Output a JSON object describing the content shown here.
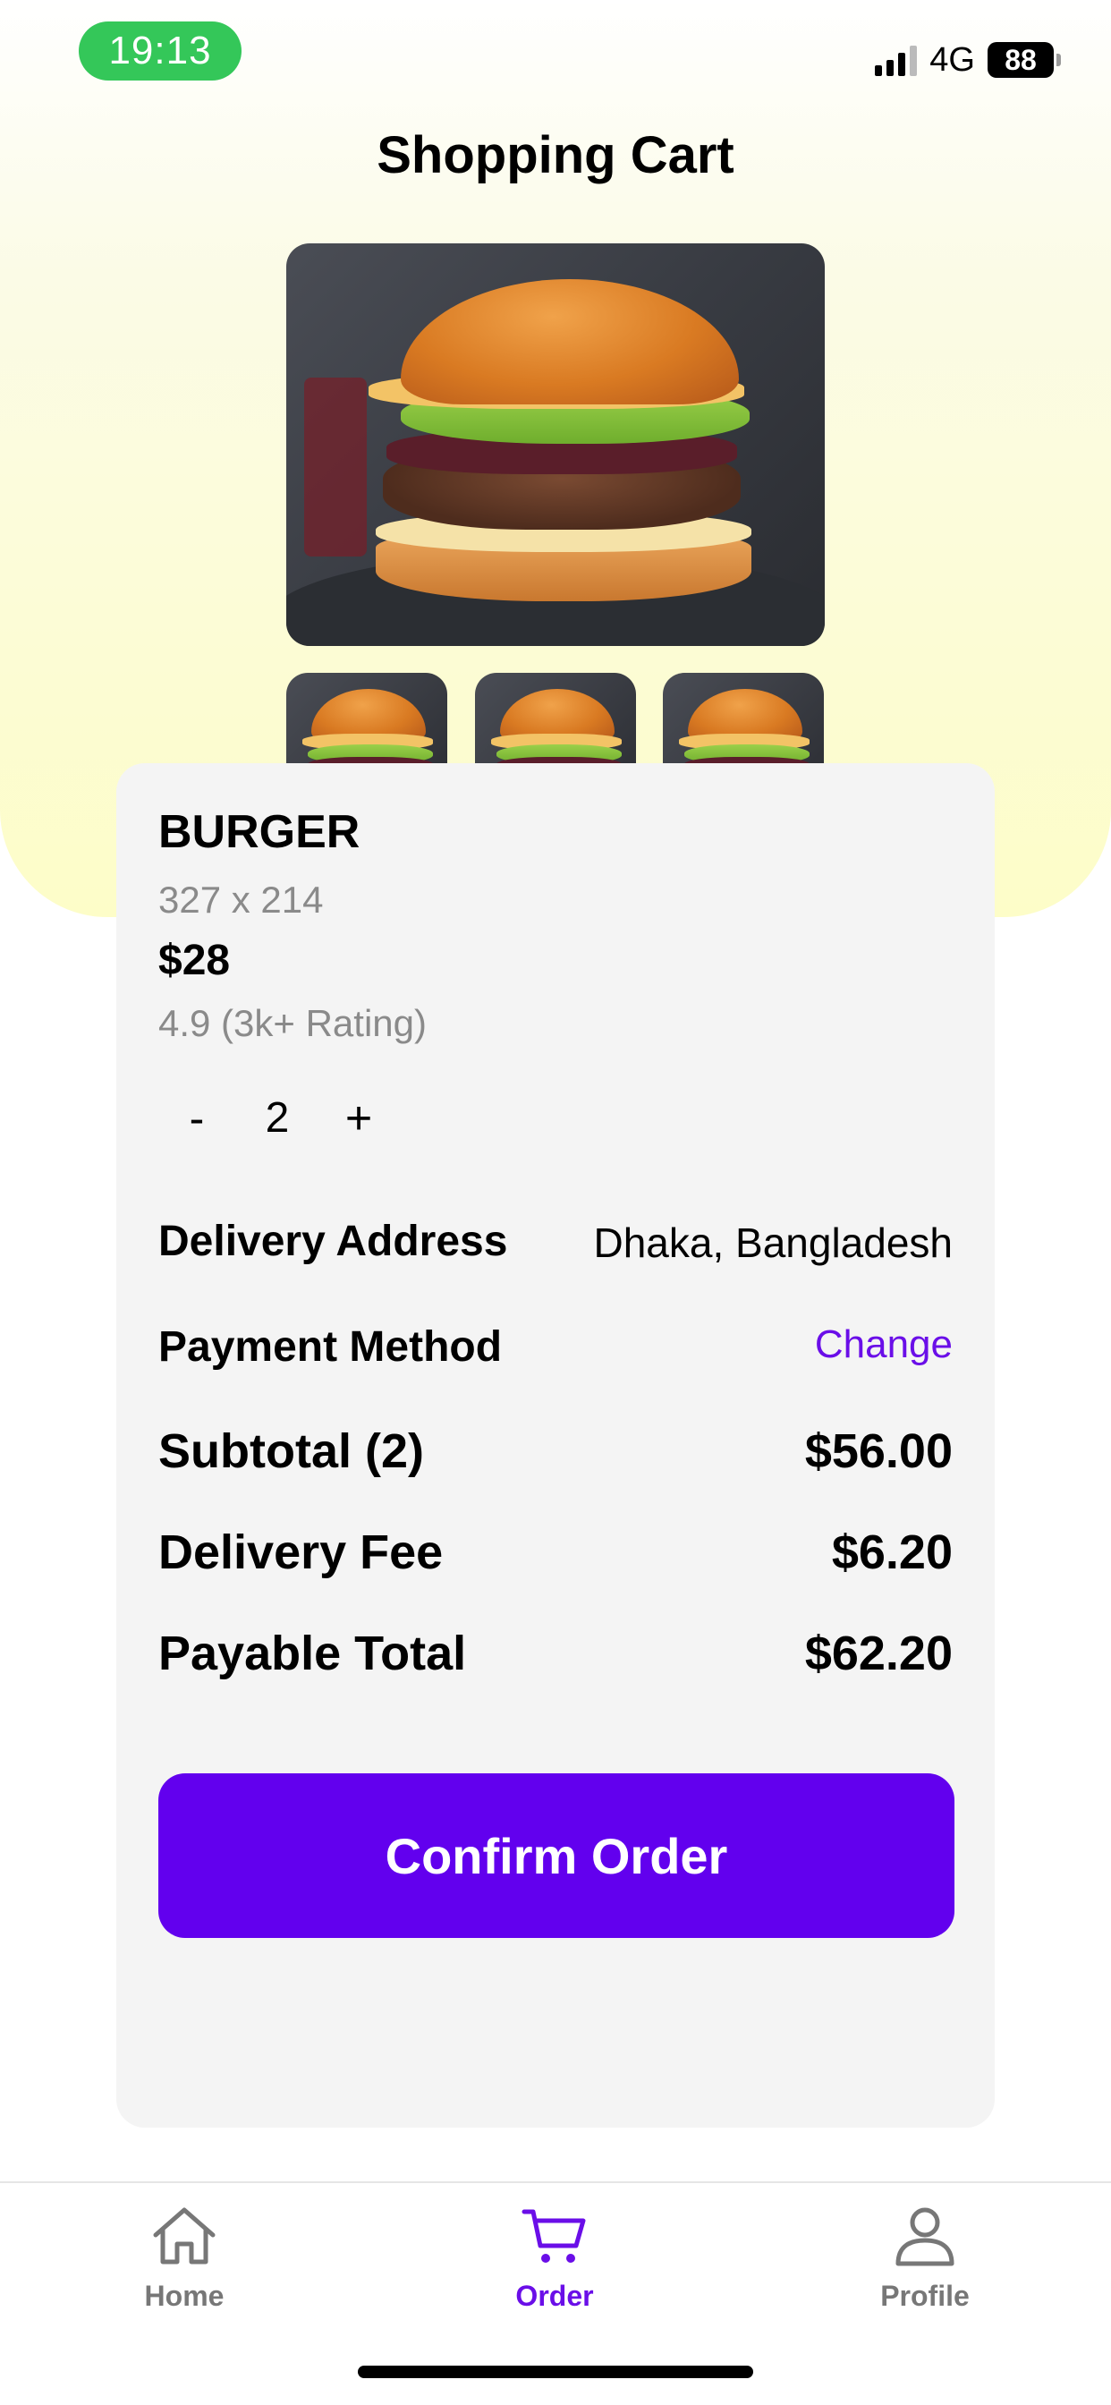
{
  "status_bar": {
    "time": "19:13",
    "network": "4G",
    "battery": "88"
  },
  "header": {
    "title": "Shopping Cart"
  },
  "product": {
    "name": "BURGER",
    "dimensions": "327 x 214",
    "price": "$28",
    "rating": "4.9 (3k+ Rating)",
    "quantity": "2",
    "minus_label": "-",
    "plus_label": "+"
  },
  "details": {
    "delivery_address_label": "Delivery Address",
    "delivery_address_value": "Dhaka, Bangladesh",
    "payment_method_label": "Payment Method",
    "payment_method_action": "Change",
    "subtotal_label": "Subtotal (2)",
    "subtotal_value": "$56.00",
    "delivery_fee_label": "Delivery Fee",
    "delivery_fee_value": "$6.20",
    "payable_total_label": "Payable Total",
    "payable_total_value": "$62.20"
  },
  "actions": {
    "confirm_label": "Confirm Order"
  },
  "nav": {
    "items": [
      {
        "label": "Home",
        "icon": "home-icon",
        "active": false
      },
      {
        "label": "Order",
        "icon": "cart-icon",
        "active": true
      },
      {
        "label": "Profile",
        "icon": "person-icon",
        "active": false
      }
    ]
  },
  "colors": {
    "accent": "#6200ee",
    "status_time_bg": "#34c759",
    "card_bg": "#f4f4f4",
    "hero_bottom": "#fdfdc8"
  }
}
